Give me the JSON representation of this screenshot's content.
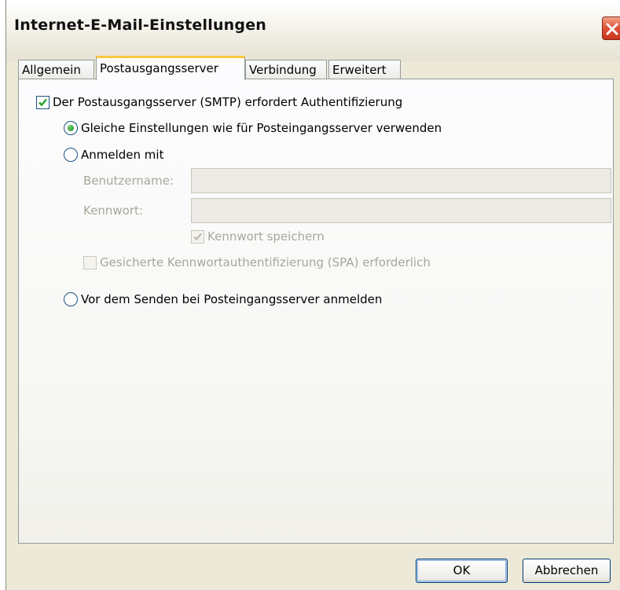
{
  "window": {
    "title": "Internet-E-Mail-Einstellungen"
  },
  "tabs": [
    {
      "label": "Allgemein",
      "active": false
    },
    {
      "label": "Postausgangsserver",
      "active": true
    },
    {
      "label": "Verbindung",
      "active": false
    },
    {
      "label": "Erweitert",
      "active": false
    }
  ],
  "auth": {
    "require_smtp_auth": {
      "label": "Der Postausgangsserver (SMTP) erfordert Authentifizierung",
      "checked": true
    },
    "options": [
      {
        "label": "Gleiche Einstellungen wie für Posteingangsserver verwenden",
        "selected": true
      },
      {
        "label": "Anmelden mit",
        "selected": false
      },
      {
        "label": "Vor dem Senden bei Posteingangsserver anmelden",
        "selected": false
      }
    ],
    "username": {
      "label": "Benutzername:",
      "value": ""
    },
    "password": {
      "label": "Kennwort:",
      "value": ""
    },
    "save_password": {
      "label": "Kennwort speichern",
      "checked": true,
      "enabled": false
    },
    "spa": {
      "label": "Gesicherte Kennwortauthentifizierung (SPA) erforderlich",
      "checked": false,
      "enabled": false
    }
  },
  "buttons": {
    "ok": "OK",
    "cancel": "Abbrechen"
  },
  "colors": {
    "face": "#ece9d8",
    "active_tab_accent": "#ffc83c",
    "check": "#21a121"
  }
}
